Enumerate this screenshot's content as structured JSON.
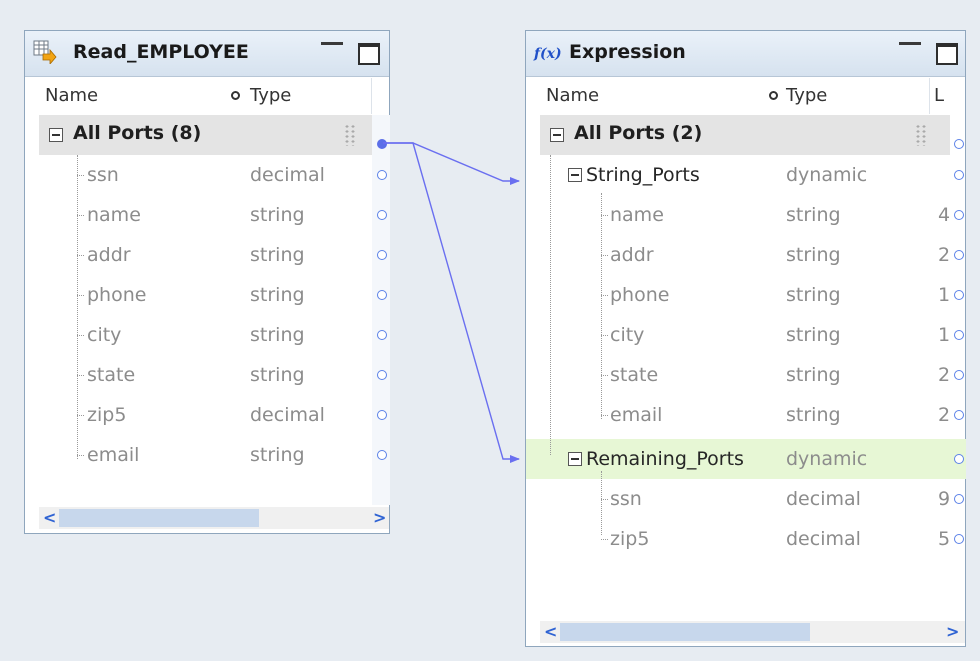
{
  "read_panel": {
    "title": "Read_EMPLOYEE",
    "col_name": "Name",
    "col_type": "Type",
    "group_label": "All Ports (8)",
    "ports": [
      {
        "name": "ssn",
        "type": "decimal"
      },
      {
        "name": "name",
        "type": "string"
      },
      {
        "name": "addr",
        "type": "string"
      },
      {
        "name": "phone",
        "type": "string"
      },
      {
        "name": "city",
        "type": "string"
      },
      {
        "name": "state",
        "type": "string"
      },
      {
        "name": "zip5",
        "type": "decimal"
      },
      {
        "name": "email",
        "type": "string"
      }
    ],
    "scroll_left": "<",
    "scroll_right": ">"
  },
  "expr_panel": {
    "icon_text": "f(x)",
    "title": "Expression",
    "col_name": "Name",
    "col_type": "Type",
    "col_len": "L",
    "group_label": "All Ports (2)",
    "string_group": {
      "name": "String_Ports",
      "type": "dynamic"
    },
    "string_ports": [
      {
        "name": "name",
        "type": "string",
        "len": "4"
      },
      {
        "name": "addr",
        "type": "string",
        "len": "2"
      },
      {
        "name": "phone",
        "type": "string",
        "len": "1"
      },
      {
        "name": "city",
        "type": "string",
        "len": "1"
      },
      {
        "name": "state",
        "type": "string",
        "len": "2"
      },
      {
        "name": "email",
        "type": "string",
        "len": "2"
      }
    ],
    "remaining_group": {
      "name": "Remaining_Ports",
      "type": "dynamic"
    },
    "remaining_ports": [
      {
        "name": "ssn",
        "type": "decimal",
        "len": "9"
      },
      {
        "name": "zip5",
        "type": "decimal",
        "len": "5"
      }
    ],
    "scroll_left": "<",
    "scroll_right": ">"
  },
  "colors": {
    "canvas": "#e7ecf2",
    "link": "#6a6ff0",
    "port": "#5c82e8",
    "highlight_row": "#e7f7d5"
  }
}
